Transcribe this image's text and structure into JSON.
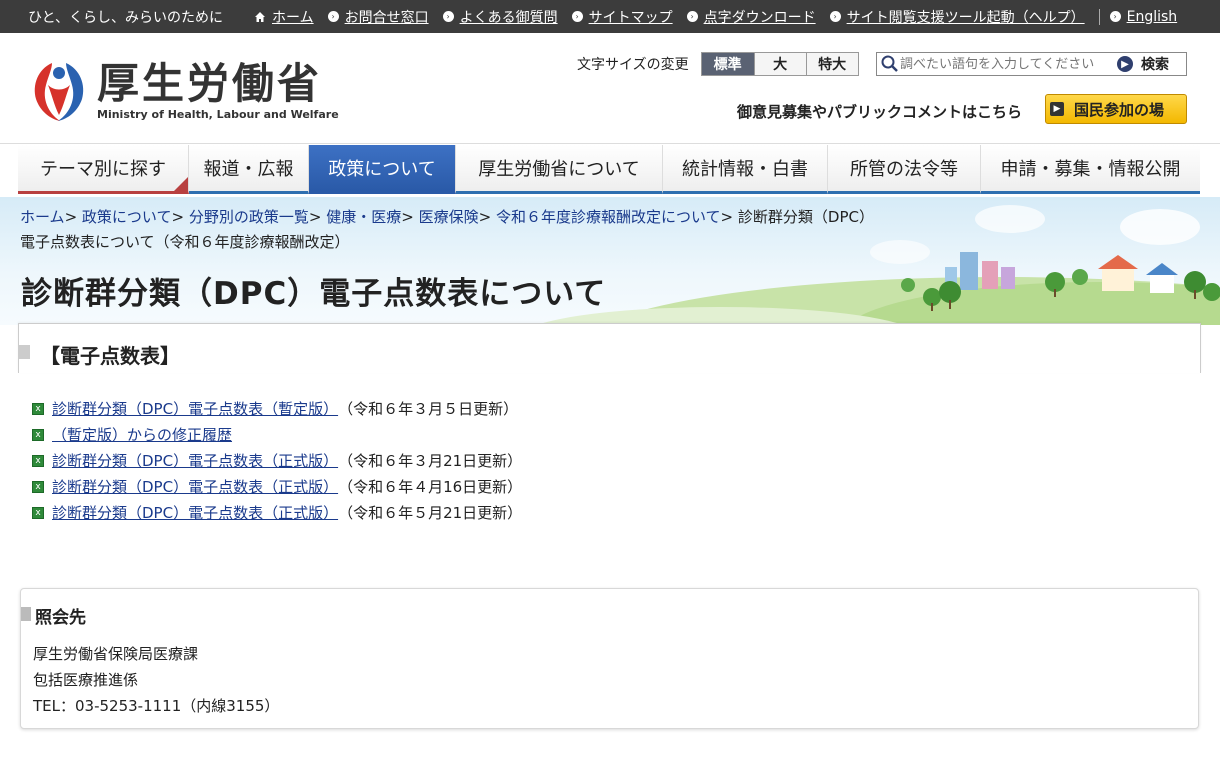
{
  "topbar": {
    "tagline": "ひと、くらし、みらいのために",
    "links": [
      {
        "label": "ホーム",
        "icon": "home-icon"
      },
      {
        "label": "お問合せ窓口",
        "icon": "bullet-arrow-icon"
      },
      {
        "label": "よくある御質問",
        "icon": "bullet-arrow-icon"
      },
      {
        "label": "サイトマップ",
        "icon": "bullet-arrow-icon"
      },
      {
        "label": "点字ダウンロード",
        "icon": "bullet-arrow-icon"
      },
      {
        "label": "サイト閲覧支援ツール起動（ヘルプ）",
        "icon": "bullet-arrow-icon"
      }
    ],
    "english": "English"
  },
  "header": {
    "logo_jp": "厚生労働省",
    "logo_en": "Ministry of Health, Labour and Welfare",
    "fontsize_label": "文字サイズの変更",
    "fontsize_options": [
      "標準",
      "大",
      "特大"
    ],
    "search_placeholder": "調べたい語句を入力してください",
    "search_button": "検索",
    "public_comment": "御意見募集やパブリックコメントはこちら",
    "kokumin_button": "国民参加の場"
  },
  "nav": [
    {
      "label": "テーマ別に探す"
    },
    {
      "label": "報道・広報"
    },
    {
      "label": "政策について"
    },
    {
      "label": "厚生労働省について"
    },
    {
      "label": "統計情報・白書"
    },
    {
      "label": "所管の法令等"
    },
    {
      "label": "申請・募集・情報公開"
    }
  ],
  "breadcrumb": {
    "links": [
      "ホーム",
      "政策について",
      "分野別の政策一覧",
      "健康・医療",
      "医療保険",
      "令和６年度診療報酬改定について"
    ],
    "separator": ">",
    "current": "診断群分類（DPC）電子点数表について（令和６年度診療報酬改定）"
  },
  "page": {
    "title": "診断群分類（DPC）電子点数表について"
  },
  "section": {
    "heading": "【電子点数表】",
    "items": [
      {
        "link": "診断群分類（DPC）電子点数表（暫定版）",
        "note": "（令和６年３月５日更新）"
      },
      {
        "link": "（暫定版）からの修正履歴",
        "note": ""
      },
      {
        "link": "診断群分類（DPC）電子点数表（正式版）",
        "note": "（令和６年３月21日更新）"
      },
      {
        "link": "診断群分類（DPC）電子点数表（正式版）",
        "note": "（令和６年４月16日更新）"
      },
      {
        "link": "診断群分類（DPC）電子点数表（正式版）",
        "note": "（令和６年５月21日更新）"
      }
    ]
  },
  "contact": {
    "heading": "照会先",
    "lines": [
      "厚生労働省保険局医療課",
      "包括医療推進係",
      "TEL：03-5253-1111（内線3155）"
    ]
  },
  "colors": {
    "topbar": "#3c3c3c",
    "nav_active": "#2a5aa8",
    "link": "#1a3a8c",
    "kokumin": "#f3b800"
  }
}
